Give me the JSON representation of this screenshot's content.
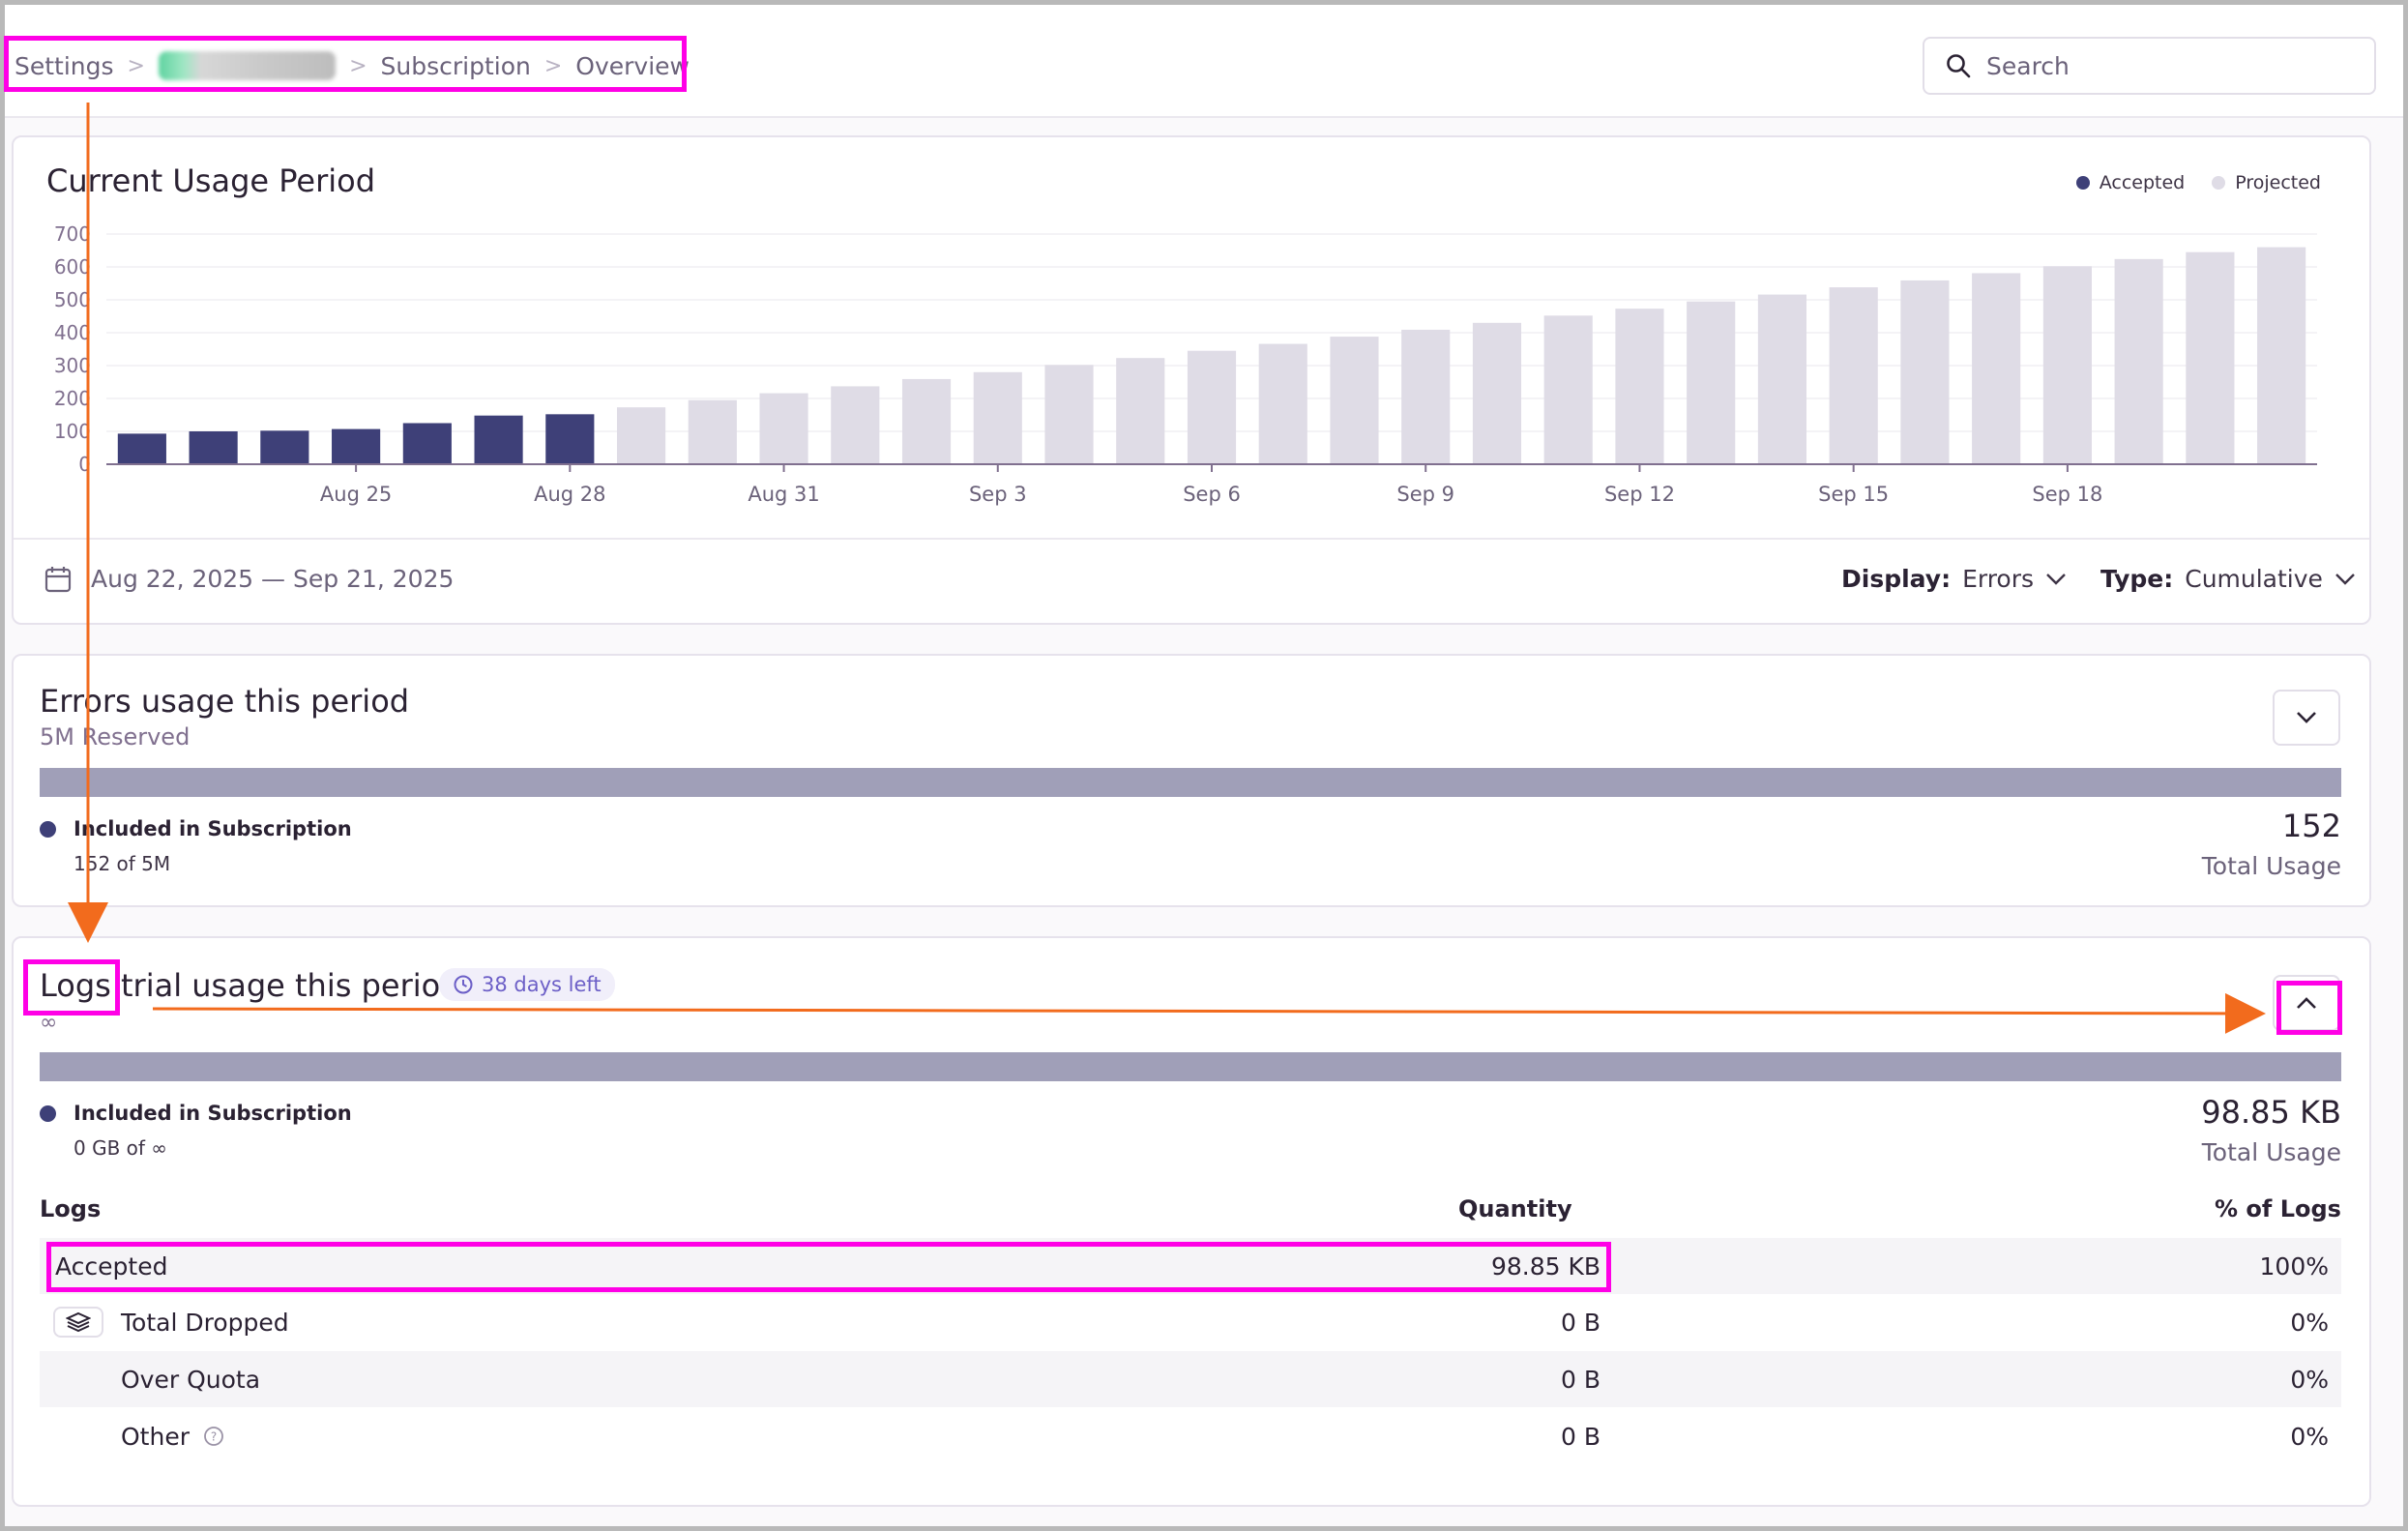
{
  "breadcrumb": {
    "items": [
      "Settings",
      "Subscription",
      "Overview"
    ],
    "separator": ">"
  },
  "search": {
    "placeholder": "Search"
  },
  "usage_chart": {
    "title": "Current Usage Period",
    "legend": [
      {
        "label": "Accepted",
        "color": "#3e4078"
      },
      {
        "label": "Projected",
        "color": "#dfdce6"
      }
    ],
    "date_range": "Aug 22, 2025 — Sep 21, 2025",
    "display": {
      "label": "Display:",
      "value": "Errors"
    },
    "type": {
      "label": "Type:",
      "value": "Cumulative"
    }
  },
  "chart_data": {
    "type": "bar",
    "ylim": [
      0,
      700
    ],
    "yticks": [
      0,
      100,
      200,
      300,
      400,
      500,
      600,
      700
    ],
    "x_tick_labels": [
      {
        "index": 3,
        "label": "Aug 25"
      },
      {
        "index": 6,
        "label": "Aug 28"
      },
      {
        "index": 9,
        "label": "Aug 31"
      },
      {
        "index": 12,
        "label": "Sep 3"
      },
      {
        "index": 15,
        "label": "Sep 6"
      },
      {
        "index": 18,
        "label": "Sep 9"
      },
      {
        "index": 21,
        "label": "Sep 12"
      },
      {
        "index": 24,
        "label": "Sep 15"
      },
      {
        "index": 27,
        "label": "Sep 18"
      }
    ],
    "series": [
      {
        "name": "Accepted",
        "color": "#3e4078",
        "values": [
          93,
          100,
          102,
          107,
          125,
          148,
          152,
          null,
          null,
          null,
          null,
          null,
          null,
          null,
          null,
          null,
          null,
          null,
          null,
          null,
          null,
          null,
          null,
          null,
          null,
          null,
          null,
          null,
          null,
          null,
          null
        ]
      },
      {
        "name": "Projected",
        "color": "#dfdce6",
        "values": [
          null,
          null,
          null,
          null,
          null,
          null,
          null,
          173,
          195,
          216,
          237,
          259,
          280,
          302,
          323,
          345,
          366,
          388,
          409,
          430,
          452,
          473,
          495,
          516,
          538,
          559,
          581,
          602,
          624,
          645,
          660
        ]
      }
    ]
  },
  "errors_usage": {
    "title": "Errors usage this period",
    "subtitle": "5M Reserved",
    "included_title": "Included in Subscription",
    "included_sub": "152 of 5M",
    "total_value": "152",
    "total_label": "Total Usage"
  },
  "logs_usage": {
    "title_word": "Logs",
    "title_rest": "trial usage this period",
    "badge": "38 days left",
    "subtitle": "∞",
    "included_title": "Included in Subscription",
    "included_sub": "0 GB of ∞",
    "total_value": "98.85 KB",
    "total_label": "Total Usage",
    "table": {
      "headers": [
        "Logs",
        "Quantity",
        "% of Logs"
      ],
      "rows": [
        {
          "label": "Accepted",
          "quantity": "98.85 KB",
          "percent": "100%"
        },
        {
          "label": "Total Dropped",
          "quantity": "0 B",
          "percent": "0%"
        },
        {
          "label": "Over Quota",
          "quantity": "0 B",
          "percent": "0%"
        },
        {
          "label": "Other",
          "quantity": "0 B",
          "percent": "0%"
        }
      ]
    }
  },
  "colors": {
    "accent_highlight": "#ff00e6",
    "arrow": "#f26b1d",
    "accepted": "#3e4078",
    "projected": "#dfdce6",
    "usage_bar": "#a09fb8"
  }
}
